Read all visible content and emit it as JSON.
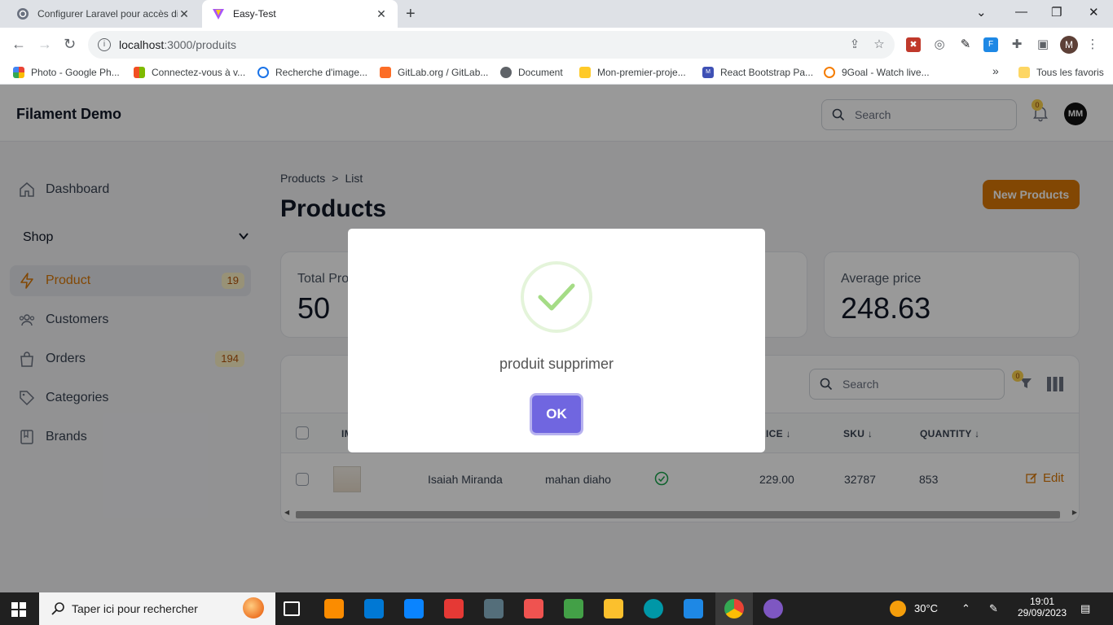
{
  "browser": {
    "tabs": [
      {
        "title": "Configurer Laravel pour accès di",
        "active": false
      },
      {
        "title": "Easy-Test",
        "active": true
      }
    ],
    "url_host": "localhost",
    "url_rest": ":3000/produits",
    "bookmarks": [
      "Photo - Google Ph...",
      "Connectez-vous à v...",
      "Recherche d'image...",
      "GitLab.org / GitLab...",
      "Document",
      "Mon-premier-proje...",
      "React Bootstrap Pa...",
      "9Goal - Watch live..."
    ],
    "bookmarks_more": "»",
    "all_bookmarks": "Tous les favoris",
    "profile_initial": "M"
  },
  "app": {
    "brand": "Filament Demo",
    "search_placeholder": "Search",
    "notifications_count": "0",
    "user_initials": "MM"
  },
  "sidebar": {
    "dashboard": "Dashboard",
    "group": "Shop",
    "items": [
      {
        "label": "Product",
        "count": "19",
        "active": true
      },
      {
        "label": "Customers",
        "count": "",
        "active": false
      },
      {
        "label": "Orders",
        "count": "194",
        "active": false
      },
      {
        "label": "Categories",
        "count": "",
        "active": false
      },
      {
        "label": "Brands",
        "count": "",
        "active": false
      }
    ]
  },
  "page": {
    "breadcrumb": [
      "Products",
      ">",
      "List"
    ],
    "title": "Products",
    "new_button": "New Products"
  },
  "stats": [
    {
      "label": "Total Pro",
      "value": "50"
    },
    {
      "label": "Average price",
      "value": "248.63"
    }
  ],
  "table": {
    "search_placeholder": "Search",
    "filter_count": "0",
    "columns": [
      "IM",
      "RICE",
      "SKU",
      "QUANTITY"
    ],
    "rows": [
      {
        "name": "Isaiah Miranda",
        "brand": "mahan diaho",
        "price": "229.00",
        "sku": "32787",
        "quantity": "853",
        "edit": "Edit"
      }
    ]
  },
  "modal": {
    "message": "produit supprimer",
    "ok_label": "OK",
    "accent": "#7066e0",
    "success": "#a5dc86"
  },
  "taskbar": {
    "search_placeholder": "Taper ici pour rechercher",
    "temperature": "30°C",
    "time": "19:01",
    "date": "29/09/2023"
  }
}
